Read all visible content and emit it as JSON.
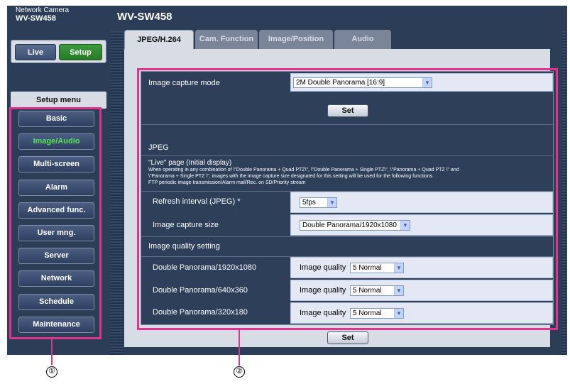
{
  "header": {
    "brand_small": "Network Camera",
    "brand_model": "WV-SW458",
    "page_title": "WV-SW458"
  },
  "nav": {
    "live": "Live",
    "setup": "Setup",
    "setup_menu_label": "Setup menu",
    "items": [
      {
        "label": "Basic",
        "active": false
      },
      {
        "label": "Image/Audio",
        "active": true
      },
      {
        "label": "Multi-screen",
        "active": false
      },
      {
        "label": "Alarm",
        "active": false
      },
      {
        "label": "Advanced func.",
        "active": false
      },
      {
        "label": "User mng.",
        "active": false
      },
      {
        "label": "Server",
        "active": false
      },
      {
        "label": "Network",
        "active": false
      },
      {
        "label": "Schedule",
        "active": false
      },
      {
        "label": "Maintenance",
        "active": false
      }
    ]
  },
  "tabs": {
    "items": [
      "JPEG/H.264",
      "Cam. Function",
      "Image/Position",
      "Audio"
    ],
    "active": "JPEG/H.264"
  },
  "capture": {
    "label": "Image capture mode",
    "value": "2M Double Panorama [16:9]"
  },
  "set_label": "Set",
  "jpeg": {
    "section_title": "JPEG",
    "live_page_title": "\"Live\" page (Initial display)",
    "note_lines": [
      "When operating in any combination of \\\"Double Panorama + Quad PTZ\\\", \\\"Double Panorama + Single PTZ\\\", \\\"Panorama + Quad PTZ \\\" and",
      "\\\"Panorama + Single PTZ \\\", images with the image capture size designated for this setting will be used for the following functions.",
      "FTP periodic image transmission/Alarm mail/Rec. on SD/Priority stream"
    ],
    "refresh_label": "Refresh interval (JPEG) *",
    "refresh_value": "5fps",
    "size_label": "Image capture size",
    "size_value": "Double Panorama/1920x1080",
    "quality_title": "Image quality setting",
    "quality_prefix": "Image quality",
    "quality_rows": [
      {
        "label": "Double Panorama/1920x1080",
        "value": "5 Normal"
      },
      {
        "label": "Double Panorama/640x360",
        "value": "5 Normal"
      },
      {
        "label": "Double Panorama/320x180",
        "value": "5 Normal"
      }
    ]
  },
  "callouts": {
    "one": "①",
    "two": "②"
  },
  "colors": {
    "frame": "#2b3d57",
    "panel": "#2e3f5a",
    "value_bg": "#e4e8f4",
    "active_green": "#56e356",
    "callout": "#e0338e"
  }
}
